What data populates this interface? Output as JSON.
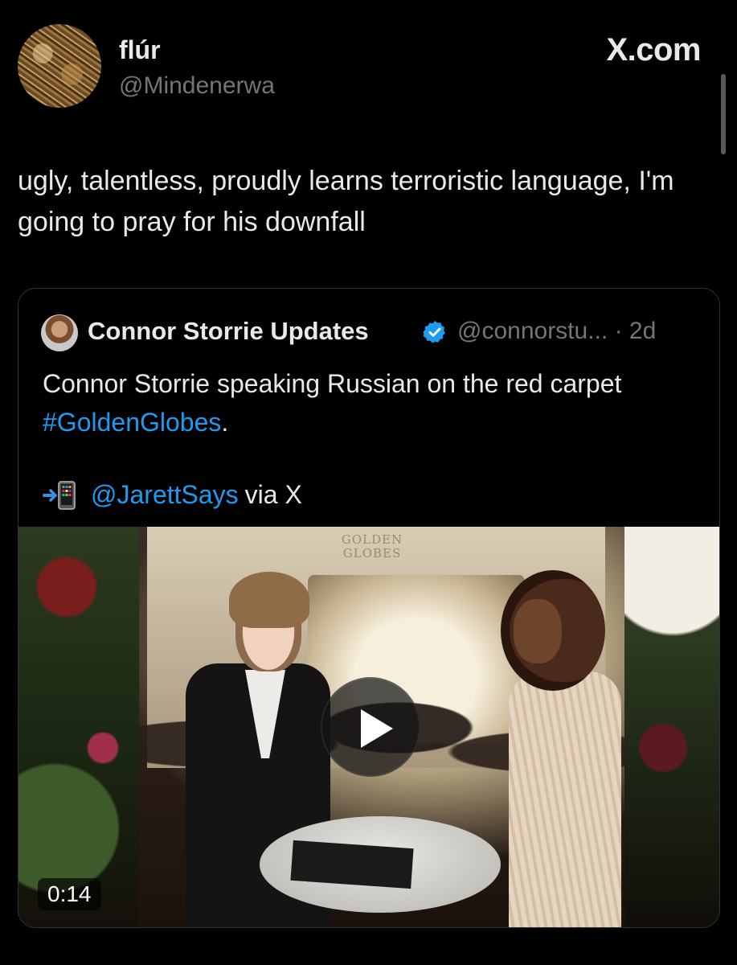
{
  "post": {
    "display_name": "flúr",
    "handle": "@Mindenerwa",
    "brand": "X.com",
    "text": "ugly, talentless, proudly learns terroristic language, I'm going to pray for his downfall"
  },
  "quoted": {
    "display_name": "Connor Storrie Updates",
    "handle": "@connorstu...",
    "time": "· 2d",
    "text": "Connor Storrie speaking Russian on the red carpet ",
    "hashtag": "#GoldenGlobes",
    "text_end": ".",
    "mention": "@JarettSays",
    "via": "via X",
    "video": {
      "background_sign": "GOLDEN GLOBES",
      "duration": "0:14"
    }
  },
  "colors": {
    "background": "#000000",
    "text": "#e7e9ea",
    "secondary_text": "#71767b",
    "link": "#1d9bf0",
    "border": "#2f3336"
  },
  "icons": {
    "verified": "verified-badge-icon",
    "phone": "mobile-phone-with-arrow-icon",
    "play": "play-icon"
  }
}
